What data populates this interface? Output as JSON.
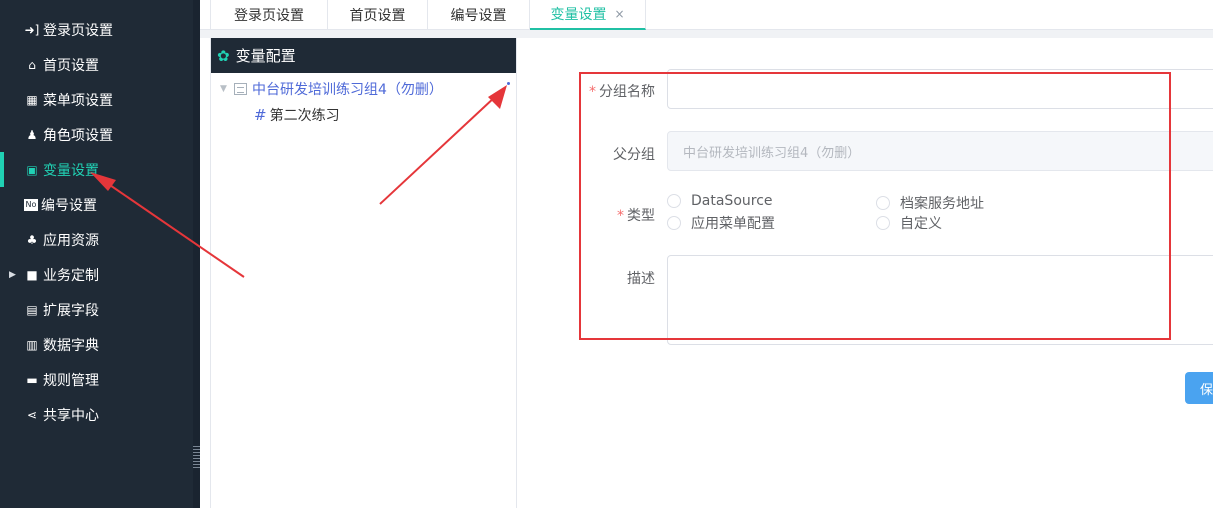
{
  "sidebar": {
    "items": [
      {
        "label": "登录页设置",
        "icon": "login-icon",
        "active": false
      },
      {
        "label": "首页设置",
        "icon": "home-icon",
        "active": false
      },
      {
        "label": "菜单项设置",
        "icon": "grid-icon",
        "active": false
      },
      {
        "label": "角色项设置",
        "icon": "user-role-icon",
        "active": false
      },
      {
        "label": "变量设置",
        "icon": "variable-icon",
        "active": true
      },
      {
        "label": "编号设置",
        "icon": "number-icon",
        "active": false
      },
      {
        "label": "应用资源",
        "icon": "resources-icon",
        "active": false
      },
      {
        "label": "业务定制",
        "icon": "briefcase-icon",
        "active": false,
        "expandable": true
      },
      {
        "label": "扩展字段",
        "icon": "extend-field-icon",
        "active": false
      },
      {
        "label": "数据字典",
        "icon": "bar-chart-icon",
        "active": false
      },
      {
        "label": "规则管理",
        "icon": "rules-icon",
        "active": false
      },
      {
        "label": "共享中心",
        "icon": "share-icon",
        "active": false
      }
    ],
    "accent_color": "#20d1b4",
    "background": "#1f2a36"
  },
  "tabs": [
    {
      "label": "登录页设置",
      "active": false
    },
    {
      "label": "首页设置",
      "active": false
    },
    {
      "label": "编号设置",
      "active": false
    },
    {
      "label": "变量设置",
      "active": true,
      "close": "×"
    }
  ],
  "tree": {
    "title": "变量配置",
    "root": "中台研发培训练习组4（勿删）",
    "child": "第二次练习"
  },
  "form": {
    "group_name_label": "分组名称",
    "group_name_value": "",
    "parent_label": "父分组",
    "parent_value": "中台研发培训练习组4（勿删）",
    "type_label": "类型",
    "type_options": [
      "DataSource",
      "档案服务地址",
      "应用菜单配置",
      "自定义"
    ],
    "desc_label": "描述",
    "desc_value": "",
    "required_mark": "*",
    "save_label": "保"
  },
  "annotation_color": "#e5363a"
}
